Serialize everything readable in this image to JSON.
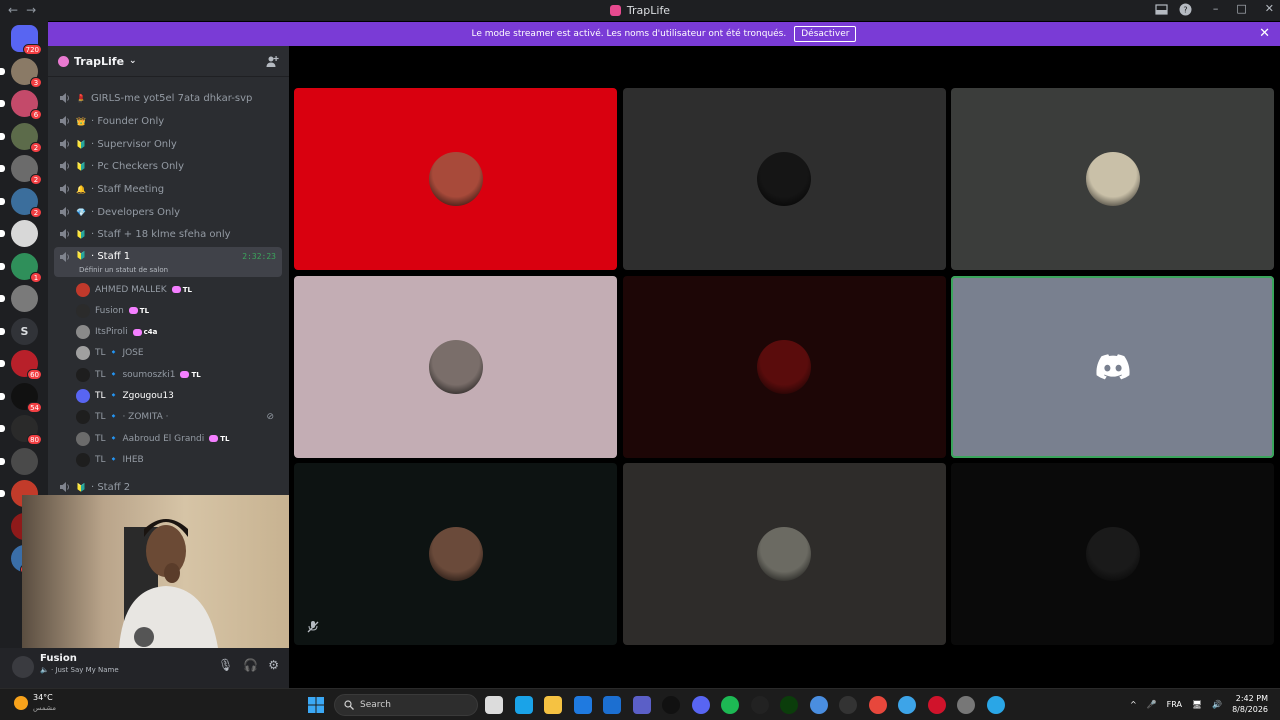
{
  "window": {
    "title": "TrapLife"
  },
  "banner": {
    "message": "Le mode streamer est activé. Les noms d'utilisateur ont été tronqués.",
    "button": "Désactiver"
  },
  "servers": [
    {
      "badge": "720",
      "color": "#5865f2"
    },
    {
      "badge": "3",
      "color": "#8a7a66"
    },
    {
      "badge": "6",
      "color": "#c44a6a"
    },
    {
      "badge": "2",
      "color": "#5c6b4a"
    },
    {
      "badge": "2",
      "color": "#6b6b6b"
    },
    {
      "badge": "2",
      "color": "#3b6e9c"
    },
    {
      "badge": "",
      "color": "#d8d8d8"
    },
    {
      "badge": "1",
      "color": "#2f8f5a"
    },
    {
      "badge": "",
      "color": "#7a7a7a"
    },
    {
      "badge": "",
      "letter": "S",
      "color": "#313338"
    },
    {
      "badge": "60",
      "color": "#b8202a"
    },
    {
      "badge": "54",
      "color": "#111111"
    },
    {
      "badge": "80",
      "color": "#2a2a2a"
    },
    {
      "badge": "",
      "color": "#4a4a4a"
    },
    {
      "badge": "",
      "color": "#c23b2a"
    },
    {
      "badge": "",
      "color": "#8f1a1a"
    },
    {
      "badge": "NOU",
      "color": "#3a6ea8"
    }
  ],
  "guild": {
    "name": "TrapLife"
  },
  "channels": [
    {
      "label": "GIRLS-me yot5el 7ata dhkar-svp",
      "emoji": "💄"
    },
    {
      "label": "· Founder Only",
      "emoji": "👑"
    },
    {
      "label": "· Supervisor Only",
      "emoji": "🔰"
    },
    {
      "label": "· Pc Checkers Only",
      "emoji": "🔰"
    },
    {
      "label": "· Staff Meeting",
      "emoji": "🔔"
    },
    {
      "label": "· Developers Only",
      "emoji": "💎"
    },
    {
      "label": "· Staff + 18 klme sfeha only",
      "emoji": "🔰"
    },
    {
      "label": "· Staff 1",
      "emoji": "🔰",
      "time": "2:32:23",
      "sub": "Définir un statut de salon"
    },
    {
      "label": "· Staff 2",
      "emoji": "🔰"
    }
  ],
  "members": [
    {
      "name": "AHMED MALLEK",
      "tag": "TL",
      "color": "#c0392b"
    },
    {
      "name": "Fusion",
      "tag": "TL",
      "color": "#2b2b2b"
    },
    {
      "name": "ItsPiroli",
      "tag": "c4a",
      "color": "#8a8a8a"
    },
    {
      "name": "TL 🔹 JOSE",
      "tag": "",
      "color": "#a0a0a0"
    },
    {
      "name": "TL 🔹 soumoszki1",
      "tag": "TL",
      "color": "#1e1e1e"
    },
    {
      "name": "TL 🔹 Zgougou13",
      "tag": "",
      "color": "#5865f2"
    },
    {
      "name": "TL 🔹 · ZOMITA ·",
      "tag": "",
      "color": "#1e1e1e"
    },
    {
      "name": "TL 🔹 Aabroud El Grandi",
      "tag": "TL",
      "color": "#6b6b6b"
    },
    {
      "name": "TL 🔹 IHEB",
      "tag": "",
      "color": "#1e1e1e"
    }
  ],
  "user": {
    "name": "Fusion",
    "status": "Just Say My Name"
  },
  "tiles": [
    {
      "bg": "#d9000f",
      "avatar": "#a84a3a"
    },
    {
      "bg": "#2e2e2e",
      "avatar": "#151515"
    },
    {
      "bg": "#3b3d3b",
      "avatar": "#c9c0a8"
    },
    {
      "bg": "#c3adb4",
      "avatar": "#7a6e6a"
    },
    {
      "bg": "#1d0606",
      "avatar": "#5a0c0c"
    },
    {
      "bg": "#79808f",
      "avatar": "discord",
      "speaking": true
    },
    {
      "bg": "#0d1312",
      "avatar": "#6a4a3a"
    },
    {
      "bg": "#2e2c2a",
      "avatar": "#6b6a62"
    },
    {
      "bg": "#0a0a0a",
      "avatar": "#1a1a1a"
    }
  ],
  "taskbar": {
    "weather_temp": "34°C",
    "weather_desc": "مشمس",
    "search_placeholder": "Search",
    "lang": "FRA",
    "time": "2:42 PM",
    "date": "8/8/2026"
  }
}
